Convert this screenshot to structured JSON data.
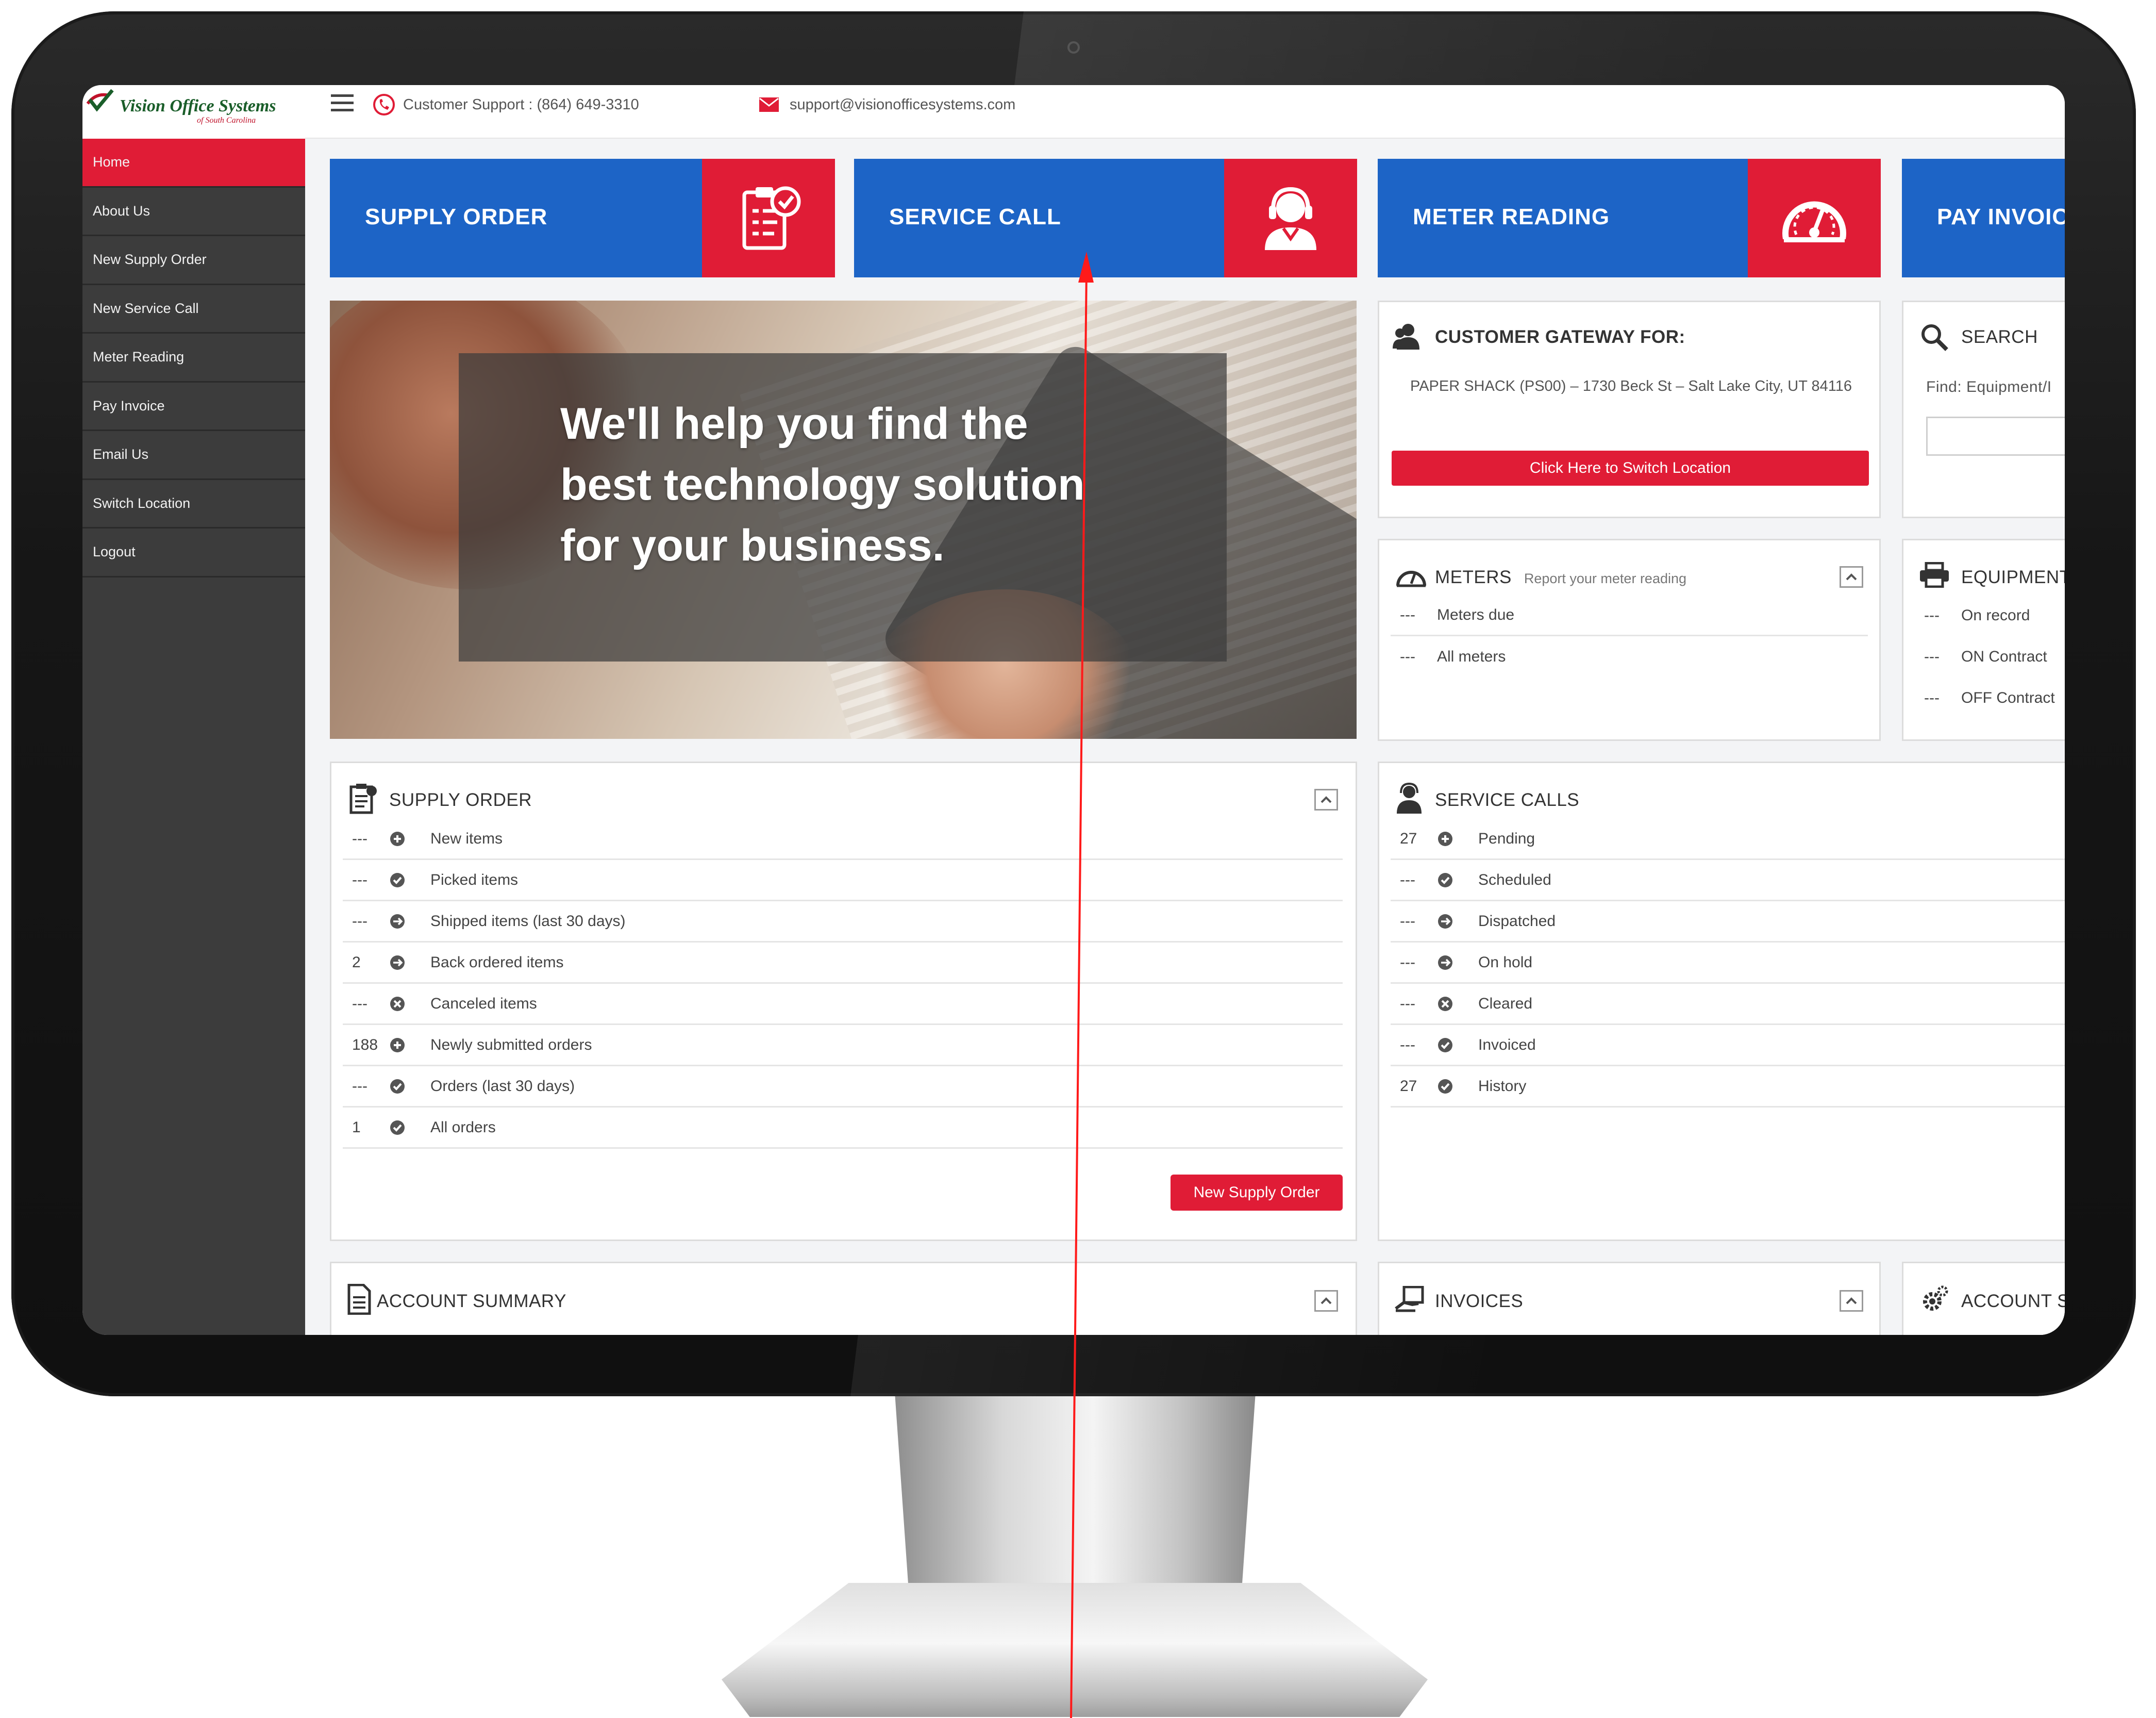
{
  "brand": {
    "name": "Vision Office Systems",
    "tagline": "of South Carolina"
  },
  "topbar": {
    "support_text": "Customer Support : (864) 649-3310",
    "email_text": "support@visionofficesystems.com"
  },
  "sidebar": {
    "items": [
      {
        "label": "Home",
        "active": true
      },
      {
        "label": "About Us"
      },
      {
        "label": "New Supply Order"
      },
      {
        "label": "New Service Call"
      },
      {
        "label": "Meter Reading"
      },
      {
        "label": "Pay Invoice"
      },
      {
        "label": "Email Us"
      },
      {
        "label": "Switch Location"
      },
      {
        "label": "Logout"
      }
    ]
  },
  "tiles": {
    "supply_order": "SUPPLY ORDER",
    "service_call": "SERVICE CALL",
    "meter_reading": "METER READING",
    "pay_invoice": "PAY INVOIC"
  },
  "hero": {
    "text": "We'll help you find the best technology solution for your business."
  },
  "gateway": {
    "title": "CUSTOMER GATEWAY FOR:",
    "address": "PAPER SHACK (PS00) – 1730 Beck St – Salt Lake City, UT 84116",
    "switch_button": "Click Here to Switch Location"
  },
  "search": {
    "title": "SEARCH",
    "find_label": "Find: Equipment/I"
  },
  "meters": {
    "title": "METERS",
    "subtitle": "Report your meter reading",
    "rows": [
      {
        "count": "---",
        "label": "Meters due"
      },
      {
        "count": "---",
        "label": "All meters"
      }
    ]
  },
  "equipment": {
    "title": "EQUIPMENT",
    "rows": [
      {
        "count": "---",
        "label": "On record"
      },
      {
        "count": "---",
        "label": "ON Contract"
      },
      {
        "count": "---",
        "label": "OFF Contract"
      }
    ]
  },
  "supply_panel": {
    "title": "SUPPLY ORDER",
    "rows": [
      {
        "count": "---",
        "label": "New items",
        "icon": "plus-circle-icon"
      },
      {
        "count": "---",
        "label": "Picked items",
        "icon": "check-circle-icon"
      },
      {
        "count": "---",
        "label": "Shipped items (last 30 days)",
        "icon": "arrow-circle-icon"
      },
      {
        "count": "2",
        "label": "Back ordered items",
        "icon": "arrow-circle-icon"
      },
      {
        "count": "---",
        "label": "Canceled items",
        "icon": "x-circle-icon"
      },
      {
        "count": "188",
        "label": "Newly submitted orders",
        "icon": "plus-circle-icon"
      },
      {
        "count": "---",
        "label": "Orders (last 30 days)",
        "icon": "check-circle-icon"
      },
      {
        "count": "1",
        "label": "All orders",
        "icon": "check-circle-icon"
      }
    ],
    "new_button": "New Supply Order"
  },
  "service_panel": {
    "title": "SERVICE CALLS",
    "rows": [
      {
        "count": "27",
        "label": "Pending",
        "icon": "plus-circle-icon"
      },
      {
        "count": "---",
        "label": "Scheduled",
        "icon": "check-circle-icon"
      },
      {
        "count": "---",
        "label": "Dispatched",
        "icon": "arrow-circle-icon"
      },
      {
        "count": "---",
        "label": "On hold",
        "icon": "arrow-circle-icon"
      },
      {
        "count": "---",
        "label": "Cleared",
        "icon": "x-circle-icon"
      },
      {
        "count": "---",
        "label": "Invoiced",
        "icon": "check-circle-icon"
      },
      {
        "count": "27",
        "label": "History",
        "icon": "check-circle-icon"
      }
    ]
  },
  "bottom": {
    "account_summary": "ACCOUNT SUMMARY",
    "invoices": "INVOICES",
    "account_settings": "ACCOUNT S"
  },
  "colors": {
    "primary_blue": "#1d64c6",
    "accent_red": "#e01c36",
    "sidebar": "#3c3c3c"
  }
}
